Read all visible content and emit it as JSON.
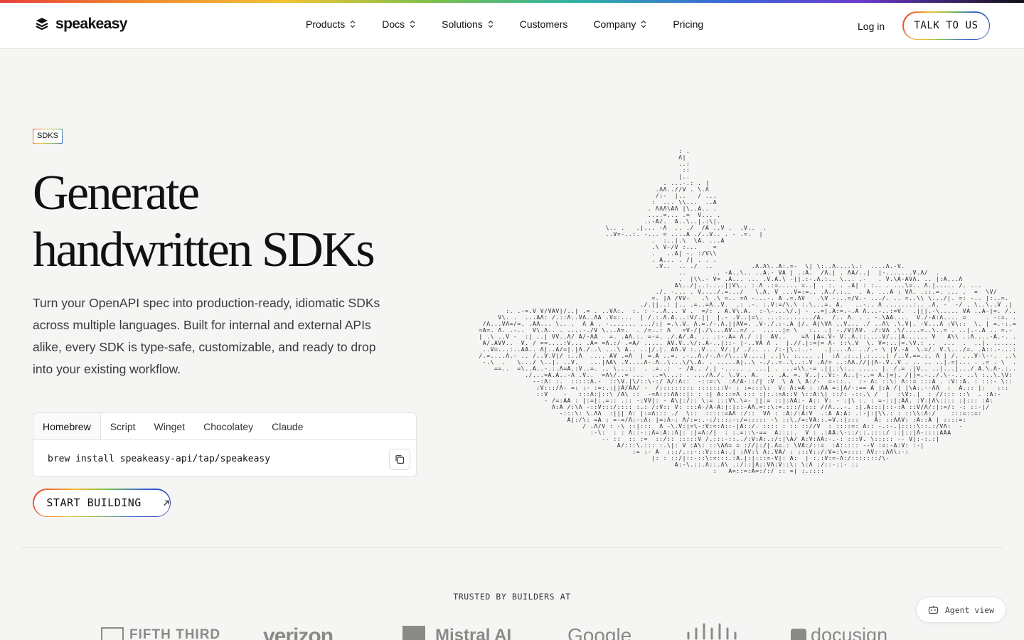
{
  "brand": {
    "name": "speakeasy"
  },
  "nav": {
    "items": [
      {
        "label": "Products",
        "has_menu": true
      },
      {
        "label": "Docs",
        "has_menu": true
      },
      {
        "label": "Solutions",
        "has_menu": true
      },
      {
        "label": "Customers",
        "has_menu": false
      },
      {
        "label": "Company",
        "has_menu": true
      },
      {
        "label": "Pricing",
        "has_menu": false
      }
    ],
    "login_label": "Log in",
    "cta_label": "TALK TO US"
  },
  "hero": {
    "badge": "SDKS",
    "title_line1": "Generate",
    "title_line2": "handwritten SDKs",
    "description": "Turn your OpenAPI spec into production-ready, idiomatic SDKs across multiple languages. Built for internal and external APIs alike, every SDK is type-safe, customizable, and ready to drop into your existing workflow.",
    "install": {
      "tabs": [
        "Homebrew",
        "Script",
        "Winget",
        "Chocolatey",
        "Claude"
      ],
      "active_tab": "Homebrew",
      "command": "brew install speakeasy-api/tap/speakeasy"
    },
    "cta_label": "START BUILDING"
  },
  "trusted": {
    "heading": "TRUSTED BY BUILDERS AT",
    "logos": [
      "FIFTH THIRD",
      "verizon",
      "Mistral AI",
      "Google",
      "cisco",
      "docusign"
    ]
  },
  "agent_view": {
    "label": "Agent view"
  },
  "colors": {
    "background": "#f5f5f4",
    "text": "#111111",
    "accent_gradient": [
      "#e6403a",
      "#f1c232",
      "#7cc04a",
      "#3a6ad8"
    ]
  }
}
